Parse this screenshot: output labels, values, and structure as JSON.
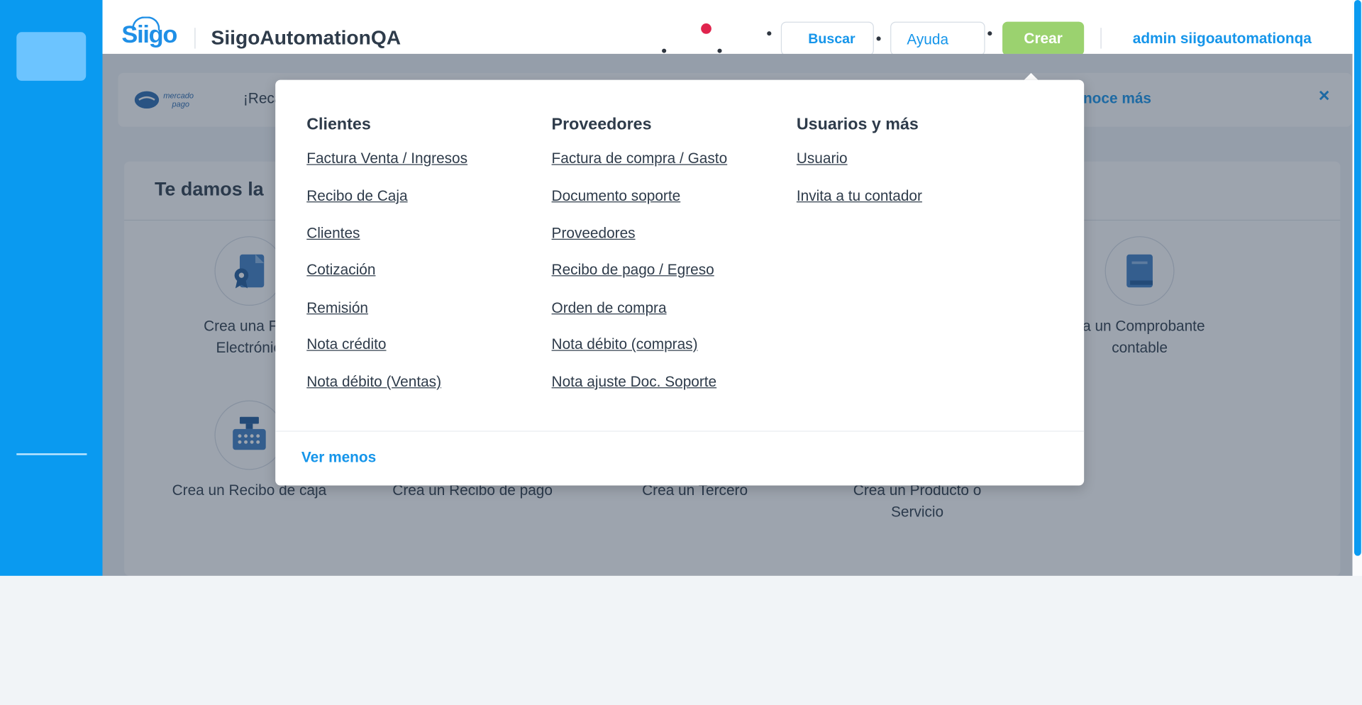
{
  "header": {
    "company_name": "SiigoAutomationQA",
    "search_label": "Buscar",
    "help_label": "Ayuda",
    "create_label": "Crear",
    "user_label": "admin siigoautomationqa"
  },
  "logo": {
    "text": "Siigo"
  },
  "banner": {
    "brand": "mercado pago",
    "text": "¡Reca",
    "link": "noce más",
    "close": "×"
  },
  "main": {
    "title": "Te damos la",
    "tiles": [
      {
        "label_line1": "Crea una Fac",
        "label_line2": "Electrónic",
        "icon": "certificate-document-icon"
      },
      {
        "label_line1": "ea un Comprobante",
        "label_line2": "contable",
        "icon": "book-icon"
      },
      {
        "label_line1": "Crea un Recibo de caja",
        "label_line2": "",
        "icon": "cash-register-icon"
      },
      {
        "label_line1": "Crea un Recibo de pago",
        "label_line2": "",
        "icon": ""
      },
      {
        "label_line1": "Crea un Tercero",
        "label_line2": "",
        "icon": ""
      },
      {
        "label_line1": "Crea un Producto o",
        "label_line2": "Servicio",
        "icon": ""
      }
    ]
  },
  "create_menu": {
    "columns": [
      {
        "title": "Clientes",
        "links": [
          "Factura Venta / Ingresos",
          "Recibo de Caja",
          "Clientes",
          "Cotización",
          "Remisión",
          "Nota crédito",
          "Nota débito (Ventas)"
        ]
      },
      {
        "title": "Proveedores",
        "links": [
          "Factura de compra / Gasto",
          "Documento soporte",
          "Proveedores",
          "Recibo de pago / Egreso",
          "Orden de compra",
          "Nota débito (compras)",
          "Nota ajuste Doc. Soporte"
        ]
      },
      {
        "title": "Usuarios y más",
        "links": [
          "Usuario",
          "Invita a tu contador"
        ]
      }
    ],
    "footer_link": "Ver menos"
  },
  "colors": {
    "sidebar": "#0a9af0",
    "accent": "#1595ea",
    "create_button": "#9bd26f",
    "notification_dot": "#e0244d"
  }
}
